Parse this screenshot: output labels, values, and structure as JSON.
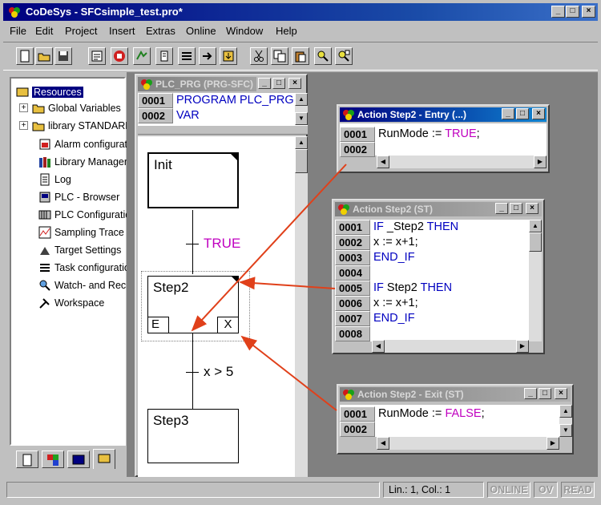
{
  "app": {
    "title": "CoDeSys - SFCsimple_test.pro*",
    "caption_min": "_",
    "caption_max": "□",
    "caption_close": "×"
  },
  "menu": [
    "File",
    "Edit",
    "Project",
    "Insert",
    "Extras",
    "Online",
    "Window",
    "Help"
  ],
  "toolbar_icons": [
    "new-icon",
    "open-icon",
    "save-icon",
    "compile-icon",
    "stop-icon",
    "run-icon",
    "step-icon",
    "step-over-icon",
    "breakpoint-icon",
    "download-icon",
    "cut-icon",
    "copy-icon",
    "paste-icon",
    "find-icon",
    "replace-icon"
  ],
  "resources": {
    "items": [
      {
        "label": "Resources",
        "icon": "resources-icon",
        "expand": ""
      },
      {
        "label": "Global Variables",
        "icon": "folder-icon",
        "expand": "+"
      },
      {
        "label": "library STANDARD",
        "icon": "folder-icon",
        "expand": "+"
      },
      {
        "label": "Alarm configuration",
        "icon": "alarm-icon",
        "expand": ""
      },
      {
        "label": "Library Manager",
        "icon": "library-icon",
        "expand": ""
      },
      {
        "label": "Log",
        "icon": "log-icon",
        "expand": ""
      },
      {
        "label": "PLC - Browser",
        "icon": "plc-browser-icon",
        "expand": ""
      },
      {
        "label": "PLC Configuration",
        "icon": "plc-config-icon",
        "expand": ""
      },
      {
        "label": "Sampling Trace",
        "icon": "trace-icon",
        "expand": ""
      },
      {
        "label": "Target Settings",
        "icon": "target-icon",
        "expand": ""
      },
      {
        "label": "Task configuration",
        "icon": "task-icon",
        "expand": ""
      },
      {
        "label": "Watch- and Recipe Manager",
        "icon": "watch-icon",
        "expand": ""
      },
      {
        "label": "Workspace",
        "icon": "workspace-icon",
        "expand": ""
      }
    ],
    "tabs": [
      "pou-tab-icon",
      "datatype-tab-icon",
      "visualization-tab-icon",
      "resources-tab-icon"
    ]
  },
  "plc_window": {
    "title": "PLC_PRG (PRG-SFC)",
    "decl_lines": [
      {
        "num": "0001",
        "parts": [
          {
            "t": "PROGRAM ",
            "c": "kw"
          },
          {
            "t": "PLC_PRG",
            "c": "kw"
          }
        ]
      },
      {
        "num": "0002",
        "parts": [
          {
            "t": "VAR",
            "c": "kw"
          }
        ]
      }
    ],
    "sfc": {
      "steps": [
        {
          "name": "Init",
          "qual_left": "",
          "qual_right": ""
        },
        {
          "name": "Step2",
          "qual_left": "E",
          "qual_right": "X"
        },
        {
          "name": "Step3",
          "qual_left": "",
          "qual_right": ""
        }
      ],
      "transitions": [
        "TRUE",
        "x > 5"
      ]
    }
  },
  "entry_window": {
    "title": "Action Step2 - Entry (...)",
    "lines": [
      {
        "num": "0001",
        "parts": [
          {
            "t": "RunMode := ",
            "c": ""
          },
          {
            "t": "TRUE",
            "c": "mg"
          },
          {
            "t": ";",
            "c": ""
          }
        ]
      },
      {
        "num": "0002",
        "parts": []
      }
    ]
  },
  "action_window": {
    "title": "Action Step2 (ST)",
    "lines": [
      {
        "num": "0001",
        "parts": [
          {
            "t": "IF ",
            "c": "kw"
          },
          {
            "t": "_Step2 ",
            "c": ""
          },
          {
            "t": "THEN",
            "c": "kw"
          }
        ]
      },
      {
        "num": "0002",
        "parts": [
          {
            "t": "x := x+1;",
            "c": ""
          }
        ]
      },
      {
        "num": "0003",
        "parts": [
          {
            "t": "END_IF",
            "c": "kw"
          }
        ]
      },
      {
        "num": "0004",
        "parts": []
      },
      {
        "num": "0005",
        "parts": [
          {
            "t": "IF ",
            "c": "kw"
          },
          {
            "t": "Step2 ",
            "c": ""
          },
          {
            "t": "THEN",
            "c": "kw"
          }
        ]
      },
      {
        "num": "0006",
        "parts": [
          {
            "t": "x := x+1;",
            "c": ""
          }
        ]
      },
      {
        "num": "0007",
        "parts": [
          {
            "t": "END_IF",
            "c": "kw"
          }
        ]
      },
      {
        "num": "0008",
        "parts": []
      }
    ]
  },
  "exit_window": {
    "title": "Action Step2 - Exit (ST)",
    "lines": [
      {
        "num": "0001",
        "parts": [
          {
            "t": "RunMode := ",
            "c": ""
          },
          {
            "t": "FALSE",
            "c": "mg"
          },
          {
            "t": ";",
            "c": ""
          }
        ]
      },
      {
        "num": "0002",
        "parts": []
      }
    ]
  },
  "status": {
    "position": "Lin.: 1, Col.: 1",
    "online": "ONLINE",
    "ov": "OV",
    "read": "READ"
  },
  "colors": {
    "title_active": "#000080",
    "keyword": "#0000c0",
    "literal": "#c000c0",
    "arrow": "#e0401a"
  }
}
